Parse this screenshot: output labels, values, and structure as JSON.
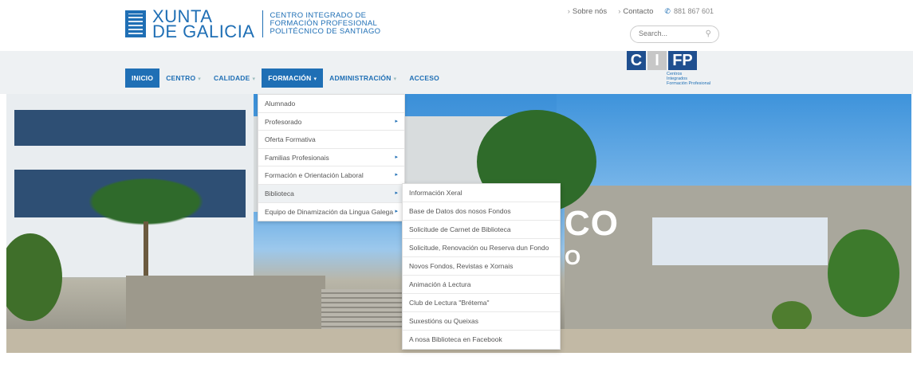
{
  "header": {
    "logo": {
      "xunta_line1": "XUNTA",
      "xunta_line2": "DE GALICIA",
      "cifp_line1": "CENTRO INTEGRADO DE",
      "cifp_line2": "FORMACIÓN PROFESIONAL",
      "cifp_line3": "POLITÉCNICO DE SANTIAGO"
    },
    "toplinks": {
      "sobre_nos": "Sobre nós",
      "contacto": "Contacto",
      "phone": "881 867 601"
    },
    "search": {
      "placeholder": "Search..."
    }
  },
  "nav": {
    "items": [
      {
        "label": "INICIO"
      },
      {
        "label": "CENTRO"
      },
      {
        "label": "CALIDADE"
      },
      {
        "label": "FORMACIÓN"
      },
      {
        "label": "ADMINISTRACIÓN"
      },
      {
        "label": "ACCESO"
      }
    ]
  },
  "cifp_badge": {
    "letters": [
      "C",
      "I",
      "FP"
    ],
    "sub_line1": "Centros",
    "sub_line2": "Integrados",
    "sub_line3": "Formación Profesional"
  },
  "hero": {
    "text1": "CO",
    "text2": "O"
  },
  "formacion_menu": {
    "items": [
      {
        "label": "Alumnado",
        "has_sub": false
      },
      {
        "label": "Profesorado",
        "has_sub": true
      },
      {
        "label": "Oferta Formativa",
        "has_sub": false
      },
      {
        "label": "Familias Profesionais",
        "has_sub": true
      },
      {
        "label": "Formación e Orientación Laboral",
        "has_sub": true
      },
      {
        "label": "Biblioteca",
        "has_sub": true
      },
      {
        "label": "Equipo de Dinamización da Lingua Galega",
        "has_sub": true
      }
    ]
  },
  "biblioteca_submenu": {
    "items": [
      "Información Xeral",
      "Base de Datos dos nosos Fondos",
      "Solicitude de Carnet de Biblioteca",
      "Solicitude, Renovación ou Reserva dun Fondo",
      "Novos Fondos, Revistas e Xornais",
      "Animación á Lectura",
      "Club de Lectura \"Brétema\"",
      "Suxestións ou Queixas",
      "A nosa Biblioteca en Facebook"
    ]
  },
  "colors": {
    "brand_blue": "#1f6fb5",
    "nav_bg": "#eef1f3"
  }
}
